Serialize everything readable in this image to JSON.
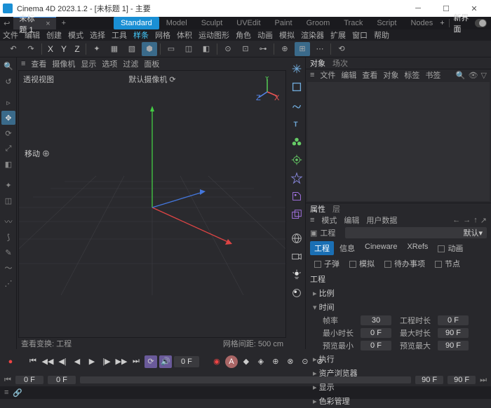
{
  "window": {
    "title": "Cinema 4D 2023.1.2 - [未标题 1] - 主要"
  },
  "docTabs": {
    "tab1": "未标题 1",
    "layout": "新界面"
  },
  "modes": [
    "Standard",
    "Model",
    "Sculpt",
    "UVEdit",
    "Paint",
    "Groom",
    "Track",
    "Script",
    "Nodes"
  ],
  "menu": [
    "文件",
    "编辑",
    "创建",
    "模式",
    "选择",
    "工具",
    "样条",
    "网格",
    "体积",
    "运动图形",
    "角色",
    "动画",
    "模拟",
    "渲染器",
    "扩展",
    "窗口",
    "帮助"
  ],
  "axes": [
    "X",
    "Y",
    "Z"
  ],
  "viewToolbar": [
    "查看",
    "摄像机",
    "显示",
    "选项",
    "过滤",
    "面板"
  ],
  "viewport": {
    "left": "透视视图",
    "center": "默认摄像机 ⟳",
    "move": "移动 ⊕",
    "statusL": "查看变换: 工程",
    "statusR": "网格间距: 500 cm"
  },
  "objects": {
    "tabs": [
      "对象",
      "场次"
    ],
    "menu": [
      "文件",
      "编辑",
      "查看",
      "对象",
      "标签",
      "书签"
    ]
  },
  "attrs": {
    "tabs": [
      "属性",
      "层"
    ],
    "menu": [
      "模式",
      "编辑",
      "用户数据"
    ],
    "projLabel": "工程",
    "projValue": "默认",
    "btns": [
      "工程",
      "信息",
      "Cineware",
      "XRefs",
      "动画",
      "子弹",
      "模拟",
      "待办事项",
      "节点"
    ],
    "sectionTitle": "工程",
    "sections": [
      "比例",
      "时间",
      "执行",
      "资产浏览器",
      "显示",
      "色彩管理"
    ],
    "time": {
      "f1l": "帧率",
      "f1v": "30",
      "f2l": "工程时长",
      "f2v": "0 F",
      "f3l": "最小时长",
      "f3v": "0 F",
      "f4l": "最大时长",
      "f4v": "90 F",
      "f5l": "预览最小",
      "f5v": "0 F",
      "f6l": "预览最大",
      "f6v": "90 F"
    }
  },
  "timeline": {
    "frame": "0 F",
    "n0": "0 F",
    "n1": "0 F",
    "n2": "90 F",
    "n3": "90 F"
  }
}
